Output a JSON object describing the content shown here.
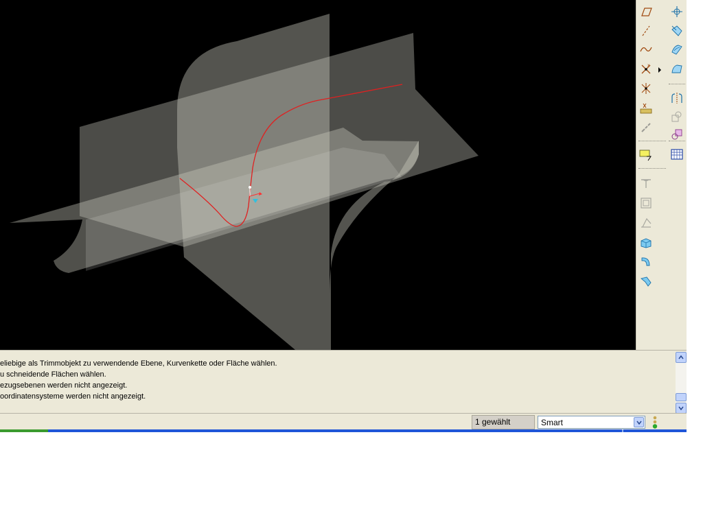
{
  "messages": [
    "eliebige als Trimmobjekt zu verwendende Ebene, Kurvenkette oder Fläche wählen.",
    "u schneidende Flächen wählen.",
    "ezugsebenen werden nicht angezeigt.",
    "oordinatensysteme werden nicht angezeigt."
  ],
  "status": {
    "selection_count": "1 gewählt",
    "selection_filter": "Smart"
  },
  "toolbar_icons": {
    "left": [
      "plane-icon",
      "datum-axis-icon",
      "sketched-curve-icon",
      "datum-point-icon",
      "offset-point-icon",
      "point-field-icon",
      "chain-link-icon",
      "note-icon",
      "round-icon",
      "shell-icon",
      "draft-icon",
      "extrude-icon",
      "sweep-icon",
      "flange-icon"
    ],
    "right": [
      "coordinate-system-icon",
      "extend-surface-icon",
      "boundary-blend-icon",
      "fill-surface-icon",
      "mirror-icon",
      "copy-icon",
      "pattern-icon",
      "table-icon"
    ]
  },
  "colors": {
    "background": "#000000",
    "surface": "#b4b4a8",
    "trim_curve": "#e02020",
    "panel": "#ece9d8"
  }
}
